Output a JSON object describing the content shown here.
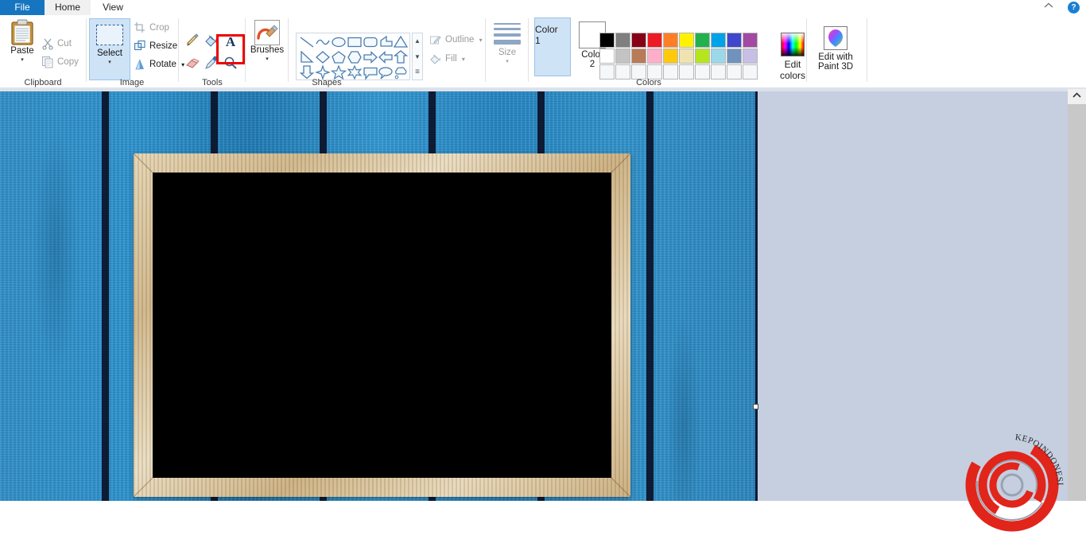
{
  "window": {
    "tabs": [
      {
        "id": "file",
        "label": "File"
      },
      {
        "id": "home",
        "label": "Home"
      },
      {
        "id": "view",
        "label": "View"
      }
    ],
    "collapse_ribbon_icon": "chevron-up-icon",
    "help_icon": "question-mark-icon",
    "help_label": "?"
  },
  "ribbon": {
    "clipboard": {
      "label": "Clipboard",
      "paste": {
        "label": "Paste",
        "icon": "clipboard-icon",
        "caret": "▾"
      },
      "cut": {
        "label": "Cut",
        "icon": "scissors-icon",
        "enabled": false
      },
      "copy": {
        "label": "Copy",
        "icon": "copy-icon",
        "enabled": false
      }
    },
    "image": {
      "label": "Image",
      "select": {
        "label": "Select",
        "icon": "selection-rectangle-icon",
        "caret": "▾",
        "active": true
      },
      "crop": {
        "label": "Crop",
        "icon": "crop-icon",
        "enabled": false
      },
      "resize": {
        "label": "Resize",
        "icon": "resize-icon",
        "enabled": true
      },
      "rotate": {
        "label": "Rotate",
        "icon": "rotate-icon",
        "enabled": true,
        "caret": "▾"
      }
    },
    "tools": {
      "label": "Tools",
      "items": [
        {
          "name": "pencil-icon",
          "title": "Pencil"
        },
        {
          "name": "fill-with-color-icon",
          "title": "Fill with color"
        },
        {
          "name": "text-tool-icon",
          "title": "Text",
          "glyph": "A",
          "highlighted": true
        },
        {
          "name": "eraser-icon",
          "title": "Eraser"
        },
        {
          "name": "color-picker-icon",
          "title": "Color picker"
        },
        {
          "name": "magnifier-icon",
          "title": "Magnifier"
        }
      ],
      "highlight_color": "#ee0000"
    },
    "brushes": {
      "label": "Brushes",
      "icon": "brush-icon",
      "caret": "▾"
    },
    "shapes": {
      "label": "Shapes",
      "items": [
        "line",
        "curve",
        "oval",
        "rectangle",
        "rounded-rectangle",
        "polygon",
        "triangle",
        "right-triangle",
        "diamond",
        "pentagon",
        "hexagon",
        "right-arrow",
        "left-arrow",
        "up-arrow",
        "down-arrow",
        "four-point-star",
        "five-point-star",
        "six-point-star",
        "rounded-callout",
        "oval-callout",
        "cloud-callout"
      ],
      "scroll_up": "▲",
      "scroll_down": "▼",
      "scroll_expand": "≡",
      "outline": {
        "label": "Outline",
        "icon": "outline-pencil-icon",
        "caret": "▾",
        "enabled": false
      },
      "fill": {
        "label": "Fill",
        "icon": "fill-bucket-icon",
        "caret": "▾",
        "enabled": false
      }
    },
    "size": {
      "label": "Size",
      "caret": "▾",
      "icon": "line-thickness-icon",
      "enabled": false
    },
    "colors": {
      "label": "Colors",
      "color1": {
        "label_top": "Color",
        "label_bottom": "1",
        "value": "#000000",
        "active": true
      },
      "color2": {
        "label_top": "Color",
        "label_bottom": "2",
        "value": "#ffffff",
        "active": false
      },
      "row1": [
        "#000000",
        "#7f7f7f",
        "#880015",
        "#ed1c24",
        "#ff7f27",
        "#fff200",
        "#22b14c",
        "#00a2e8",
        "#3f48cc",
        "#a349a4"
      ],
      "row2": [
        "#ffffff",
        "#c3c3c3",
        "#b97a57",
        "#ffaec9",
        "#ffc90e",
        "#efe4b0",
        "#b5e61d",
        "#99d9ea",
        "#7092be",
        "#c8bfe7"
      ],
      "row3": [
        "#f5f7fa",
        "#f5f7fa",
        "#f5f7fa",
        "#f5f7fa",
        "#f5f7fa",
        "#f5f7fa",
        "#f5f7fa",
        "#f5f7fa",
        "#f5f7fa",
        "#f5f7fa"
      ],
      "edit_colors": {
        "label_top": "Edit",
        "label_bottom": "colors",
        "icon": "color-spectrum-icon"
      }
    },
    "paint3d": {
      "label_top": "Edit with",
      "label_bottom": "Paint 3D",
      "icon": "paint-3d-icon"
    }
  },
  "canvas": {
    "description": "blue-wooden-plank-background-with-wooden-picture-frame",
    "plank_color": "#2b8cc6",
    "plank_gap_color": "#0a1228",
    "frame_color": "#d8c49a",
    "frame_interior_color": "#000000",
    "resize_handle": "canvas-resize-handle"
  },
  "watermark": {
    "text": "KEPOINDONESIA",
    "color": "#e1251b"
  },
  "scrollbar": {
    "up_arrow": "⌃",
    "track_color": "#c8c8c8"
  }
}
